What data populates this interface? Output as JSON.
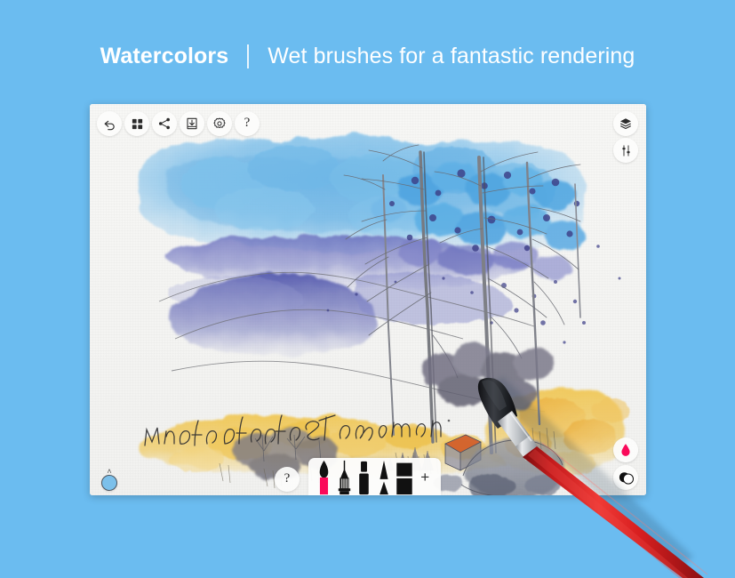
{
  "header": {
    "title": "Watercolors",
    "subtitle": "Wet brushes for a fantastic rendering"
  },
  "colors": {
    "background": "#6bbcf0",
    "panel": "#f5f5f3",
    "accent_pink": "#fa0a5a",
    "brush_handle_red": "#d81f20",
    "size_dot_blue": "#7cc0ea"
  },
  "toolbar": {
    "top_left": [
      {
        "name": "undo-button",
        "icon": "undo-icon",
        "label": "Undo"
      },
      {
        "name": "gallery-button",
        "icon": "grid-icon",
        "label": "Gallery"
      },
      {
        "name": "share-button",
        "icon": "share-icon",
        "label": "Share"
      },
      {
        "name": "import-button",
        "icon": "download-icon",
        "label": "Import"
      },
      {
        "name": "settings-button",
        "icon": "gear-icon",
        "label": "Settings"
      },
      {
        "name": "help-button-top",
        "icon": "question-mark-icon",
        "label": "?"
      }
    ],
    "right": [
      {
        "name": "layers-button",
        "icon": "layers-icon",
        "label": "Layers"
      },
      {
        "name": "adjustments-button",
        "icon": "sliders-icon",
        "label": "Adjustments"
      }
    ],
    "right_bottom": [
      {
        "name": "color-drop-button",
        "icon": "water-drop-icon",
        "label": "Color"
      },
      {
        "name": "color-wheel-button",
        "icon": "color-wheel-icon",
        "label": "Palette"
      }
    ],
    "help_bottom_label": "?"
  },
  "brush_size": {
    "chevron": "˄",
    "label": "Brush size"
  },
  "brush_palette": {
    "add_label": "+",
    "brushes": [
      {
        "name": "brush-watercolor",
        "label": "Watercolor brush",
        "selected": true
      },
      {
        "name": "brush-pencil",
        "label": "Pencil",
        "selected": false
      },
      {
        "name": "brush-marker",
        "label": "Marker",
        "selected": false
      },
      {
        "name": "brush-pen",
        "label": "Pen",
        "selected": false
      },
      {
        "name": "brush-eraser",
        "label": "Eraser",
        "selected": false
      }
    ]
  },
  "artwork": {
    "signature": "Monti della Teresima",
    "description": "Watercolor winter landscape with birch trees, blue sky wash, purple mountains, yellow fields, gray rocks and a small house with an orange roof"
  }
}
